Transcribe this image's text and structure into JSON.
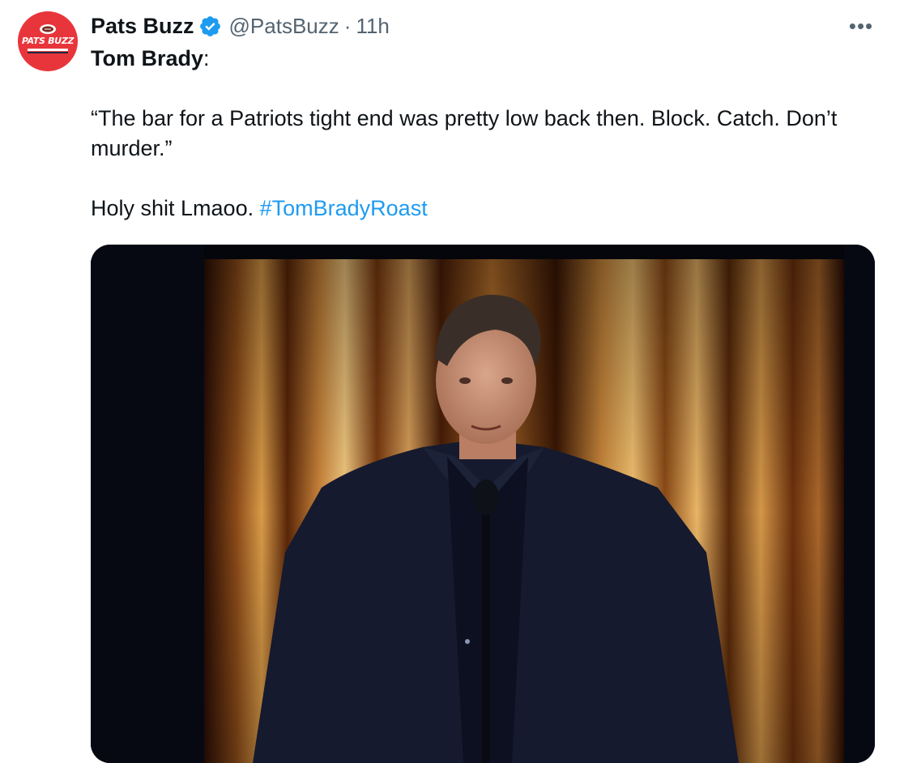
{
  "tweet": {
    "avatar_text": "PATS BUZZ",
    "display_name": "Pats Buzz",
    "verified_icon": "verified-badge-icon",
    "handle": "@PatsBuzz",
    "separator": "·",
    "time": "11h",
    "more_label": "•••",
    "author_line": "Tom Brady",
    "author_colon": ":",
    "quote": "“The bar for a Patriots tight end was pretty low back then. Block. Catch. Don’t murder.”",
    "comment": "Holy shit Lmaoo.",
    "hashtag": "#TomBradyRoast"
  },
  "colors": {
    "text_primary": "#0f1419",
    "text_secondary": "#536471",
    "accent_link": "#1d9bf0",
    "verified_blue": "#1d9bf0",
    "avatar_red": "#e8353b"
  },
  "media": {
    "kind": "photo",
    "subject": "man-in-dark-suit-at-microphone",
    "background": "gold-curtain-stage"
  }
}
